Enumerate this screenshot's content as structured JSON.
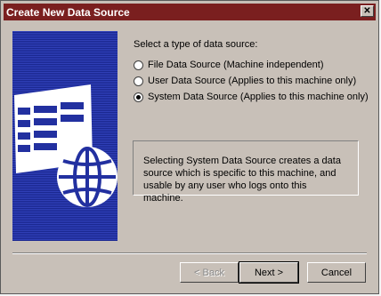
{
  "window": {
    "title": "Create New Data Source"
  },
  "prompt": "Select a type of data source:",
  "options": [
    {
      "label": "File Data Source (Machine independent)",
      "checked": false
    },
    {
      "label": "User Data Source (Applies to this machine only)",
      "checked": false
    },
    {
      "label": "System Data Source (Applies to this machine only)",
      "checked": true
    }
  ],
  "description": "Selecting System Data Source creates a data source which is specific to this machine, and usable by any user who logs onto this machine.",
  "buttons": {
    "back": "< Back",
    "next": "Next >",
    "cancel": "Cancel"
  },
  "icons": {
    "close": "close-icon",
    "banner": "datasource-globe-icon"
  },
  "colors": {
    "titlebar": "#7a1f1f",
    "face": "#c8c0b8",
    "banner": "#2230a0"
  }
}
